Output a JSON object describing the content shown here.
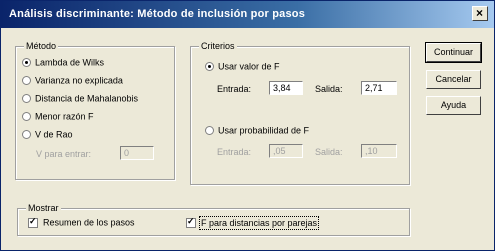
{
  "window": {
    "title": "Análisis discriminante: Método de inclusión por pasos"
  },
  "metodo": {
    "legend": "Método",
    "options": [
      {
        "label": "Lambda de Wilks",
        "selected": true
      },
      {
        "label": "Varianza no explicada",
        "selected": false
      },
      {
        "label": "Distancia de Mahalanobis",
        "selected": false
      },
      {
        "label": "Menor razón F",
        "selected": false
      },
      {
        "label": "V de Rao",
        "selected": false
      }
    ],
    "v_entrar_label": "V para entrar:",
    "v_entrar_value": "0"
  },
  "criterios": {
    "legend": "Criterios",
    "usar_valor_f": {
      "label": "Usar valor de F",
      "selected": true
    },
    "entrada_label": "Entrada:",
    "entrada_value": "3,84",
    "salida_label": "Salida:",
    "salida_value": "2,71",
    "usar_probabilidad_f": {
      "label": "Usar probabilidad de F",
      "selected": false
    },
    "p_entrada_label": "Entrada:",
    "p_entrada_value": ",05",
    "p_salida_label": "Salida:",
    "p_salida_value": ",10"
  },
  "buttons": {
    "continuar": "Continuar",
    "cancelar": "Cancelar",
    "ayuda": "Ayuda"
  },
  "mostrar": {
    "legend": "Mostrar",
    "resumen": {
      "label": "Resumen de los pasos",
      "checked": true
    },
    "f_distancias": {
      "label": "F para distancias por parejas",
      "checked": true
    }
  }
}
